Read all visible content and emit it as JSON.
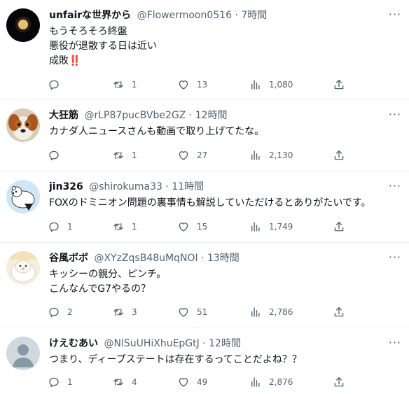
{
  "tweets": [
    {
      "name": "unfairな世界から",
      "handle": "@Flowermoon0516",
      "time": "7時間",
      "lines": [
        "もうそろそろ終盤",
        "悪役が退散する日は近い",
        "成敗"
      ],
      "emoji": "‼️",
      "replies": "",
      "retweets": "1",
      "likes": "13",
      "views": "1,080",
      "avatar": "dark-moon"
    },
    {
      "name": "大狂筋",
      "handle": "@rLP87pucBVbe2GZ",
      "time": "12時間",
      "lines": [
        "カナダ人ニュースさんも動画で取り上げてたな。"
      ],
      "replies": "",
      "retweets": "1",
      "likes": "27",
      "views": "2,130",
      "avatar": "dog"
    },
    {
      "name": "jin326",
      "handle": "@shirokuma33",
      "time": "11時間",
      "lines": [
        "FOXのドミニオン問題の裏事情も解説していただけるとありがたいです。"
      ],
      "replies": "1",
      "retweets": "1",
      "likes": "15",
      "views": "1,749",
      "avatar": "polar-bear"
    },
    {
      "name": "谷風ボボ",
      "handle": "@XYzZqsB48uMqNOI",
      "time": "13時間",
      "lines": [
        "キッシーの親分、ピンチ。",
        "こんなんでG7やるの？"
      ],
      "replies": "2",
      "retweets": "3",
      "likes": "51",
      "views": "2,786",
      "avatar": "sheep"
    },
    {
      "name": "けえむあい",
      "handle": "@NlSuUHiXhuEpGtJ",
      "time": "12時間",
      "lines": [
        "つまり、ディープステートは存在するってことだよね？？"
      ],
      "replies": "1",
      "retweets": "4",
      "likes": "49",
      "views": "2,876",
      "avatar": "default"
    }
  ],
  "separator": "·",
  "colors": {
    "text": "#0f1419",
    "secondary": "#536471",
    "border": "#eff3f4"
  }
}
